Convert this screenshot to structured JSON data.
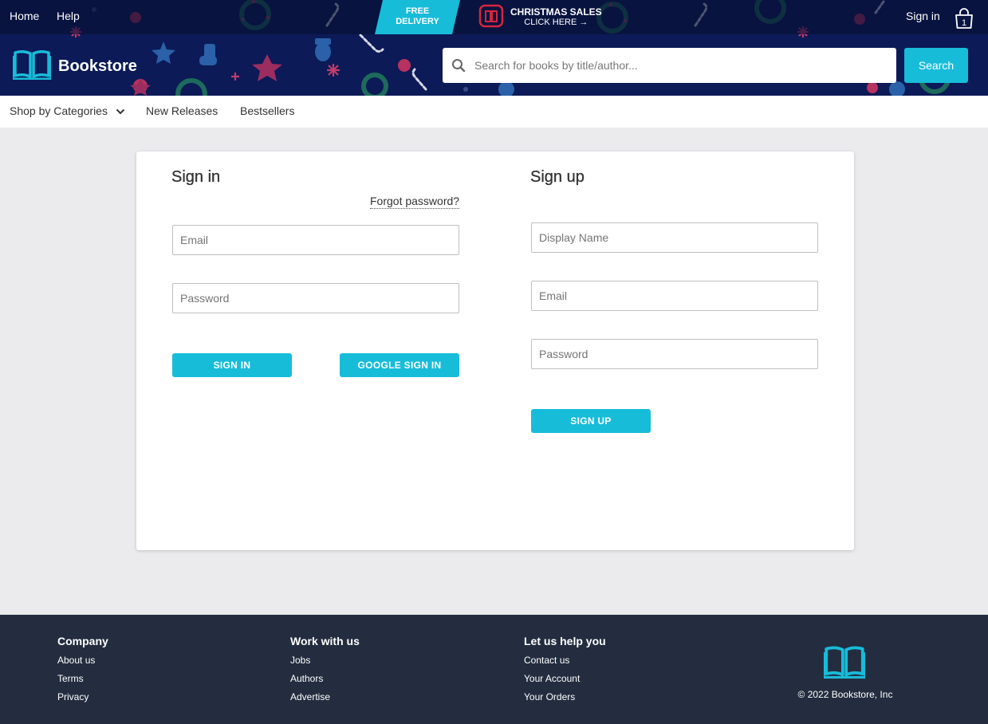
{
  "topbar": {
    "home": "Home",
    "help": "Help",
    "free_delivery_line1": "FREE",
    "free_delivery_line2": "DELIVERY",
    "promo_title": "CHRISTMAS SALES",
    "promo_cta": "CLICK HERE →",
    "sign_in": "Sign in",
    "cart_count": "1"
  },
  "brand": {
    "name": "Bookstore"
  },
  "search": {
    "placeholder": "Search for books by title/author...",
    "button": "Search"
  },
  "nav": {
    "categories": "Shop by Categories",
    "new_releases": "New Releases",
    "bestsellers": "Bestsellers"
  },
  "signin": {
    "title": "Sign in",
    "forgot": "Forgot password?",
    "email_placeholder": "Email",
    "password_placeholder": "Password",
    "signin_button": "SIGN IN",
    "google_button": "GOOGLE SIGN IN"
  },
  "signup": {
    "title": "Sign up",
    "display_name_placeholder": "Display Name",
    "email_placeholder": "Email",
    "password_placeholder": "Password",
    "signup_button": "SIGN UP"
  },
  "footer": {
    "company": {
      "title": "Company",
      "links": [
        "About us",
        "Terms",
        "Privacy"
      ]
    },
    "work": {
      "title": "Work with us",
      "links": [
        "Jobs",
        "Authors",
        "Advertise"
      ]
    },
    "help": {
      "title": "Let us help you",
      "links": [
        "Contact us",
        "Your Account",
        "Your Orders"
      ]
    },
    "copyright": "© 2022 Bookstore, Inc"
  },
  "colors": {
    "accent": "#17bcd9",
    "header_bg": "#0c1a57",
    "footer_bg": "#232d3f",
    "page_bg": "#ebebee"
  }
}
